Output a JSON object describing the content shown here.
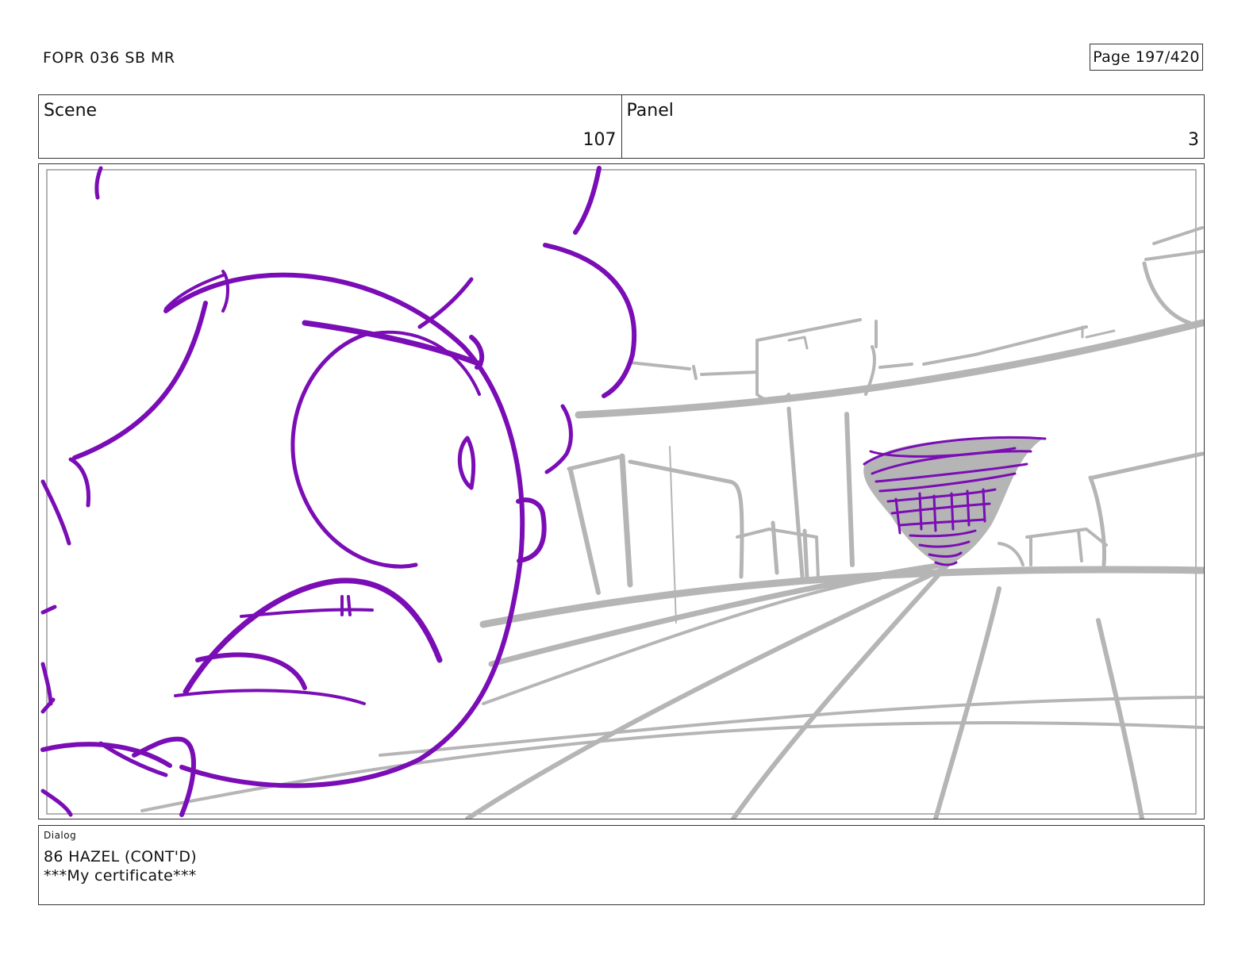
{
  "header": {
    "title": "FOPR 036 SB MR",
    "page": "Page 197/420"
  },
  "scene": {
    "label": "Scene",
    "value": "107"
  },
  "panel": {
    "label": "Panel",
    "value": "3"
  },
  "dialog": {
    "label": "Dialog",
    "lines": [
      "86 HAZEL (CONT'D)",
      "***My certificate***"
    ]
  },
  "drawing": {
    "character_color": "#7a0db5",
    "background_color": "#b5b5b5"
  }
}
